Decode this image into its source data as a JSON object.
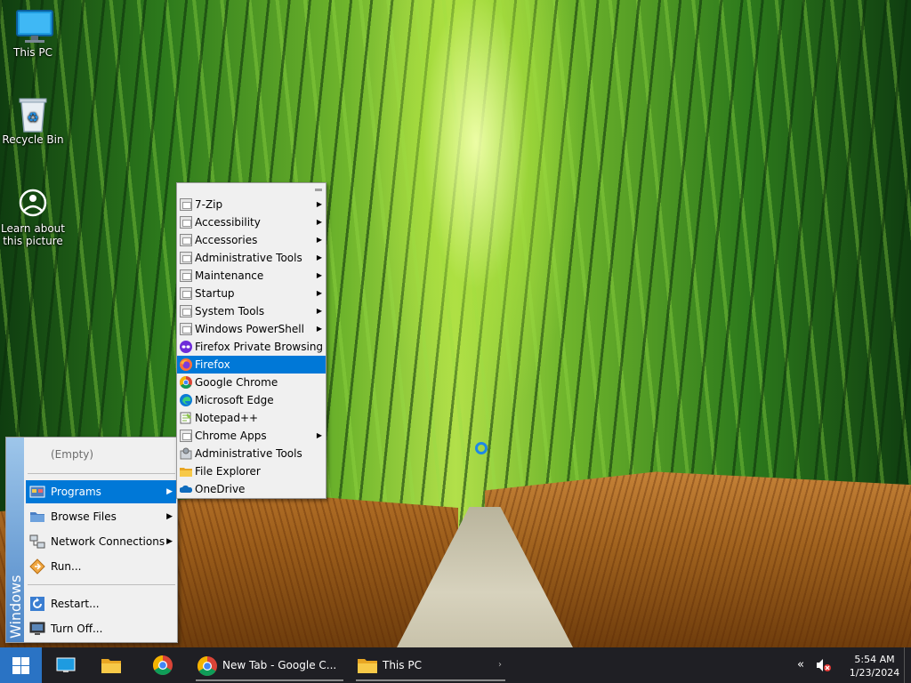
{
  "desktop": {
    "icons": [
      {
        "label": "This PC"
      },
      {
        "label": "Recycle Bin"
      },
      {
        "label": "Learn about this picture"
      }
    ]
  },
  "start_menu": {
    "band_label": "Windows",
    "items": [
      {
        "label": "(Empty)"
      },
      {
        "label": "Programs",
        "selected": true,
        "has_submenu": true
      },
      {
        "label": "Browse Files",
        "has_submenu": true
      },
      {
        "label": "Network Connections",
        "has_submenu": true
      },
      {
        "label": "Run..."
      },
      {
        "label": "Restart..."
      },
      {
        "label": "Turn Off..."
      }
    ]
  },
  "programs_submenu": {
    "items": [
      {
        "label": "7-Zip",
        "icon": "folder-icon",
        "has_submenu": true
      },
      {
        "label": "Accessibility",
        "icon": "folder-icon",
        "has_submenu": true
      },
      {
        "label": "Accessories",
        "icon": "folder-icon",
        "has_submenu": true
      },
      {
        "label": "Administrative Tools",
        "icon": "folder-icon",
        "has_submenu": true
      },
      {
        "label": "Maintenance",
        "icon": "folder-icon",
        "has_submenu": true
      },
      {
        "label": "Startup",
        "icon": "folder-icon",
        "has_submenu": true
      },
      {
        "label": "System Tools",
        "icon": "folder-icon",
        "has_submenu": true
      },
      {
        "label": "Windows PowerShell",
        "icon": "folder-icon",
        "has_submenu": true
      },
      {
        "label": "Firefox Private Browsing",
        "icon": "firefox-private-icon"
      },
      {
        "label": "Firefox",
        "icon": "firefox-icon",
        "selected": true
      },
      {
        "label": "Google Chrome",
        "icon": "chrome-icon"
      },
      {
        "label": "Microsoft Edge",
        "icon": "edge-icon"
      },
      {
        "label": "Notepad++",
        "icon": "notepad-icon"
      },
      {
        "label": "Chrome Apps",
        "icon": "folder-icon",
        "has_submenu": true
      },
      {
        "label": "Administrative Tools",
        "icon": "admin-tools-icon"
      },
      {
        "label": "File Explorer",
        "icon": "file-explorer-icon"
      },
      {
        "label": "OneDrive",
        "icon": "onedrive-icon"
      }
    ]
  },
  "taskbar": {
    "tasks": [
      {
        "label": "New Tab - Google C..."
      },
      {
        "label": "This PC"
      }
    ],
    "clock": {
      "time": "5:54 AM",
      "date": "1/23/2024"
    }
  },
  "colors": {
    "accent": "#0078d7",
    "taskbar": "#1f1f24",
    "start_button": "#2a73c4"
  }
}
